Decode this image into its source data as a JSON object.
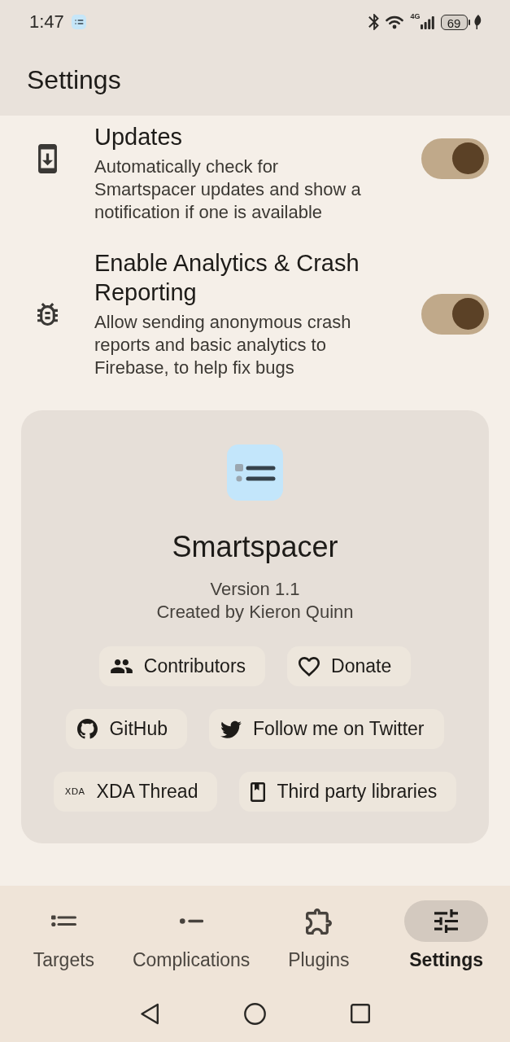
{
  "status_bar": {
    "time": "1:47",
    "network": "4G",
    "battery": "69"
  },
  "app_bar": {
    "title": "Settings"
  },
  "settings": [
    {
      "kind": "switch",
      "title": "Updates",
      "description": "Automatically check for Smartspacer updates and show a notification if one is available",
      "on": true
    },
    {
      "kind": "switch",
      "title": "Enable Analytics & Crash Reporting",
      "description": "Allow sending anonymous crash reports and basic analytics to Firebase, to help fix bugs",
      "on": true
    }
  ],
  "about": {
    "app_name": "Smartspacer",
    "version": "Version 1.1",
    "author": "Created by Kieron Quinn",
    "link_rows": [
      [
        {
          "label": "Contributors"
        },
        {
          "label": "Donate"
        }
      ],
      [
        {
          "label": "GitHub"
        },
        {
          "label": "Follow me on Twitter"
        }
      ],
      [
        {
          "logo": "XDA",
          "label": "XDA Thread"
        },
        {
          "label": "Third party libraries"
        }
      ]
    ]
  },
  "bottom_nav": [
    {
      "label": "Targets",
      "selected": false
    },
    {
      "label": "Complications",
      "selected": false
    },
    {
      "label": "Plugins",
      "selected": false
    },
    {
      "label": "Settings",
      "selected": true
    }
  ]
}
